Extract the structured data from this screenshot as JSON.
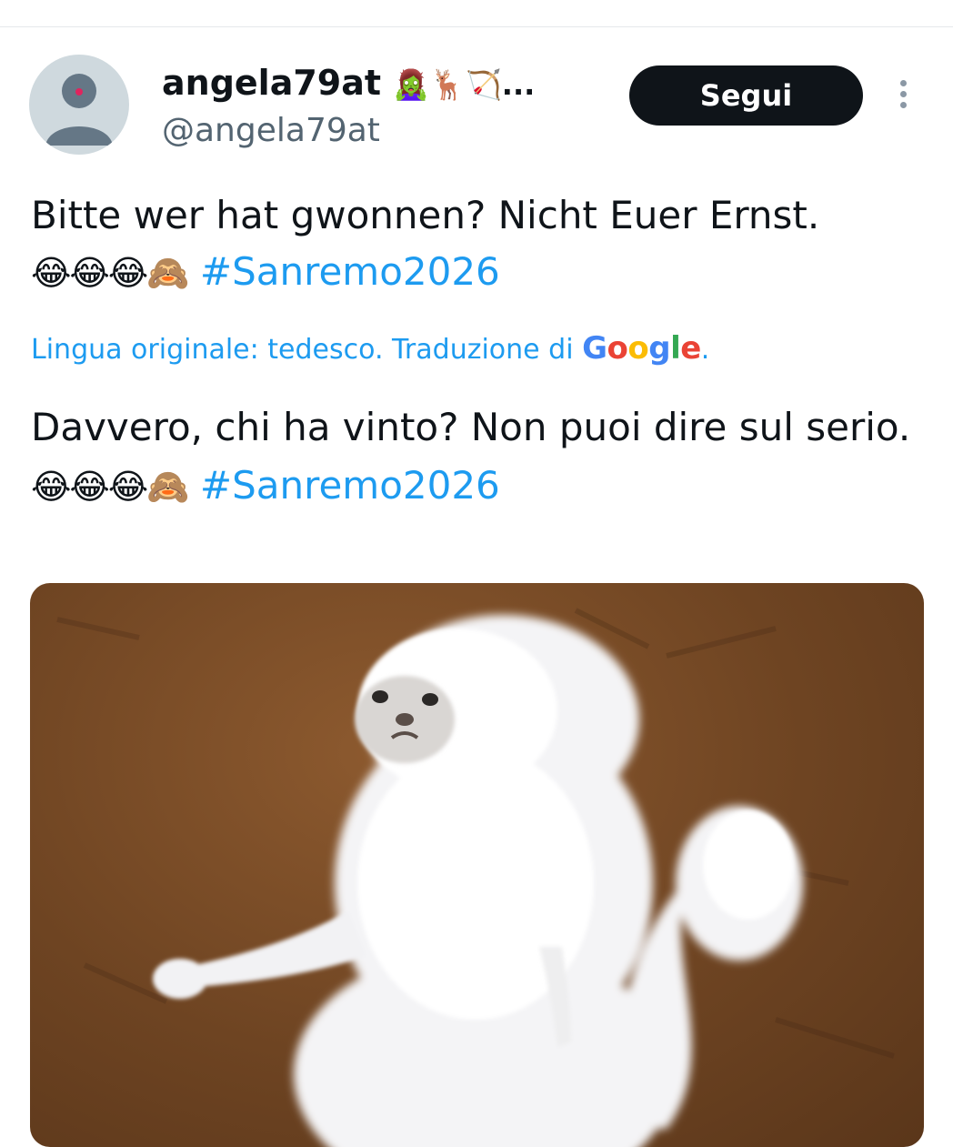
{
  "tweet": {
    "author": {
      "display_name": "angela79at",
      "name_emojis": "🧟‍♀️🦌🏹...",
      "handle": "@angela79at"
    },
    "follow_label": "Segui",
    "text": {
      "line1": "Bitte wer hat gwonnen? Nicht Euer Ernst.",
      "emojis": "😂😂😂🙈",
      "hashtag": "#Sanremo2026"
    },
    "translation": {
      "notice": "Lingua originale: tedesco. Traduzione di",
      "provider_letters": [
        "G",
        "o",
        "o",
        "g",
        "l",
        "e"
      ],
      "suffix": "."
    },
    "translated_text": {
      "line": "Davvero, chi ha vinto? Non puoi dire sul serio.",
      "emojis": "😂😂😂🙈",
      "hashtag": "#Sanremo2026"
    }
  },
  "icons": {
    "avatar": "default-avatar-icon",
    "more": "more-vertical-icon"
  },
  "colors": {
    "link": "#1d9bf0",
    "button_bg": "#0f1419",
    "secondary_text": "#536471",
    "google": [
      "#4285f4",
      "#ea4335",
      "#fbbc05",
      "#4285f4",
      "#34a853",
      "#ea4335"
    ]
  }
}
